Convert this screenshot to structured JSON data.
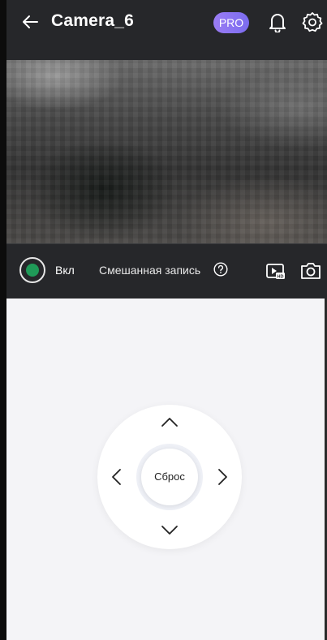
{
  "header": {
    "title": "Camera_6",
    "pro_badge": "PRO",
    "icons": [
      "back-arrow-icon",
      "bell-icon",
      "gear-icon"
    ]
  },
  "controls": {
    "record_label": "Вкл",
    "mixed_record_label": "Смешанная запись",
    "icons": [
      "help-icon",
      "hd-playback-icon",
      "camera-snapshot-icon"
    ]
  },
  "ptz": {
    "reset_label": "Сброс",
    "directions": [
      "up",
      "down",
      "left",
      "right"
    ]
  },
  "colors": {
    "header_bg": "#26272a",
    "pro_badge": "#8c74f1",
    "record_dot": "#1f9a58",
    "ptz_bg": "#f4f4f7"
  }
}
